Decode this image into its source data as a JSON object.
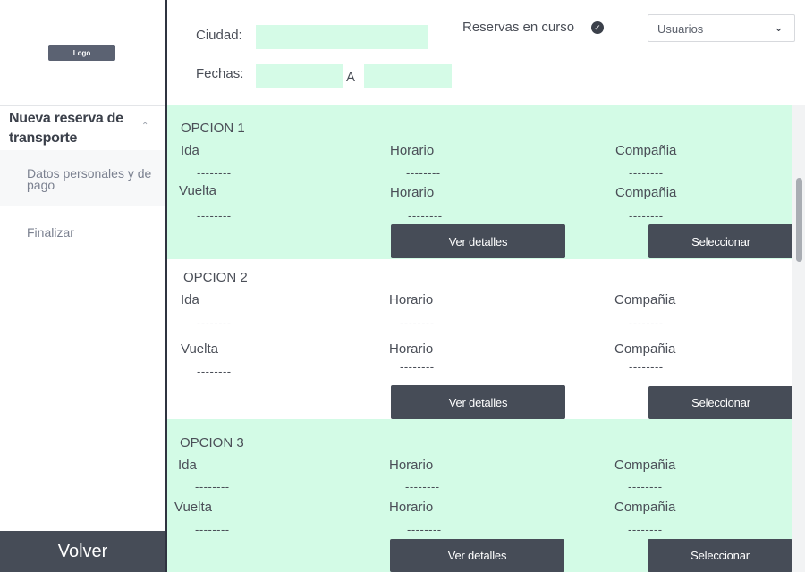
{
  "sidebar": {
    "logo": "Logo",
    "nav_heading": "Nueva reserva de transporte",
    "items": [
      {
        "label": "Datos personales y de pago"
      },
      {
        "label": "Finalizar"
      }
    ],
    "back_button": "Volver"
  },
  "filters": {
    "city_label": "Ciudad:",
    "city_value": "",
    "dates_label": "Fechas:",
    "date_from": "",
    "date_separator": "A",
    "date_to": "",
    "reservations_label": "Reservas en curso",
    "reservations_icon": "check-circle-icon",
    "users_select": "Usuarios"
  },
  "options": [
    {
      "title": "OPCION 1",
      "ida_label": "Ida",
      "ida_value": "--------",
      "horario1_label": "Horario",
      "horario1_value": "--------",
      "compania1_label": "Compañia",
      "compania1_value": "--------",
      "vuelta_label": "Vuelta",
      "vuelta_value": "--------",
      "horario2_label": "Horario",
      "horario2_value": "--------",
      "compania2_label": "Compañia",
      "compania2_value": "--------",
      "details_button": "Ver detalles",
      "select_button": "Seleccionar"
    },
    {
      "title": "OPCION 2",
      "ida_label": "Ida",
      "ida_value": "--------",
      "horario1_label": "Horario",
      "horario1_value": "--------",
      "compania1_label": "Compañia",
      "compania1_value": "--------",
      "vuelta_label": "Vuelta",
      "vuelta_value": "--------",
      "horario2_label": "Horario",
      "horario2_value": "--------",
      "compania2_label": "Compañia",
      "compania2_value": "--------",
      "details_button": "Ver detalles",
      "select_button": "Seleccionar"
    },
    {
      "title": "OPCION 3",
      "ida_label": "Ida",
      "ida_value": "--------",
      "horario1_label": "Horario",
      "horario1_value": "--------",
      "compania1_label": "Compañia",
      "compania1_value": "--------",
      "vuelta_label": "Vuelta",
      "vuelta_value": "--------",
      "horario2_label": "Horario",
      "horario2_value": "--------",
      "compania2_label": "Compañia",
      "compania2_value": "--------",
      "details_button": "Ver detalles",
      "select_button": "Seleccionar"
    }
  ],
  "colors": {
    "accent_green": "#d3fbe6",
    "dark_button": "#464c57",
    "sidebar_divider": "#2f3440"
  }
}
